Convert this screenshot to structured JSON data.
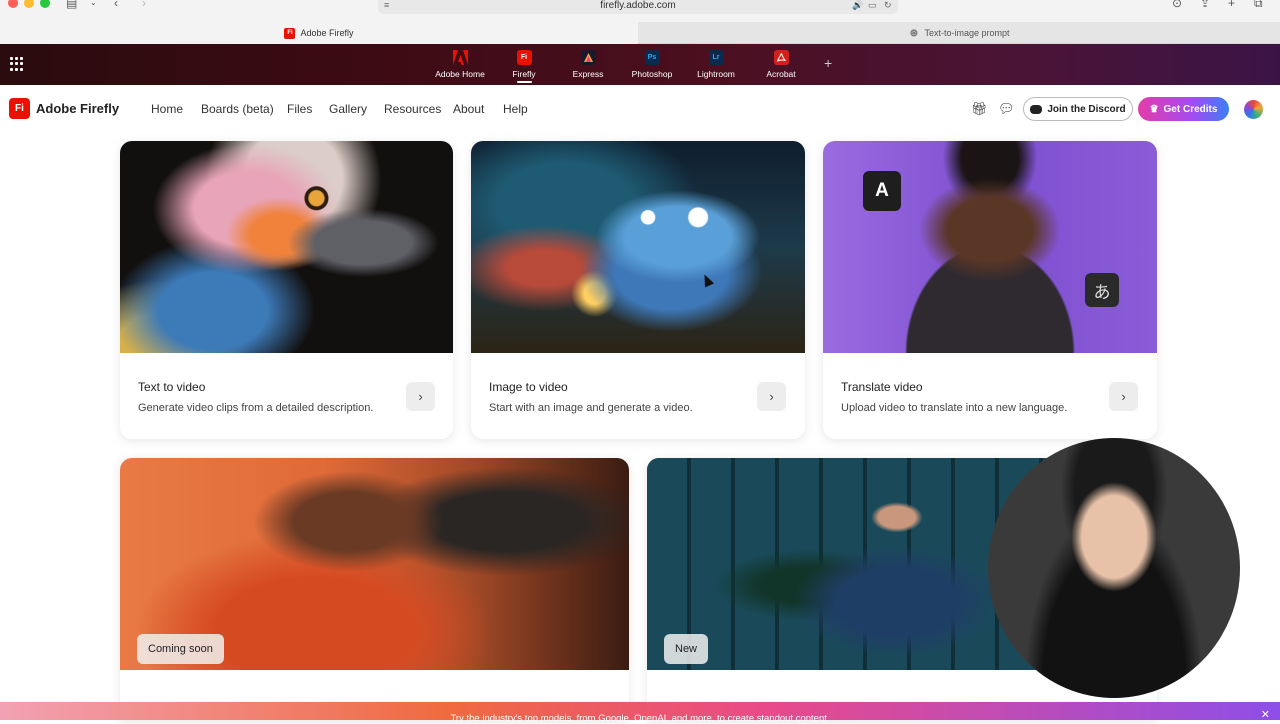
{
  "browser": {
    "url": "firefly.adobe.com",
    "tabs": [
      {
        "label": "Adobe Firefly",
        "active": true
      },
      {
        "label": "Text-to-image prompt",
        "active": false
      }
    ]
  },
  "app_switcher": {
    "apps": [
      {
        "label": "Adobe Home",
        "logo": "adobe",
        "color": "#eb1000"
      },
      {
        "label": "Firefly",
        "logo": "Fi",
        "color": "#eb1000"
      },
      {
        "label": "Express",
        "logo": "A",
        "color": "#1a1a2e"
      },
      {
        "label": "Photoshop",
        "logo": "Ps",
        "color": "#0a2a4e"
      },
      {
        "label": "Lightroom",
        "logo": "Lr",
        "color": "#0a2a4e"
      },
      {
        "label": "Acrobat",
        "logo": "A",
        "color": "#d4201c"
      }
    ],
    "active": "Firefly"
  },
  "header": {
    "logo_text": "Fi",
    "title": "Adobe Firefly",
    "nav": [
      "Home",
      "Boards (beta)",
      "Files",
      "Gallery",
      "Resources",
      "About",
      "Help"
    ],
    "discord_label": "Join the Discord",
    "credits_label": "Get Credits"
  },
  "cards": [
    {
      "title": "Text to video",
      "description": "Generate video clips from a detailed description.",
      "image": "parrot"
    },
    {
      "title": "Image to video",
      "description": "Start with an image and generate a video.",
      "image": "monster"
    },
    {
      "title": "Translate video",
      "description": "Upload video to translate into a new language.",
      "image": "man",
      "overlay_a": "A",
      "overlay_jp": "あ"
    }
  ],
  "lower_cards": [
    {
      "badge": "Coming soon",
      "image": "singer"
    },
    {
      "badge": "New",
      "image": "office"
    }
  ],
  "banner": {
    "text": "Try the industry's top models, from Google, OpenAI, and more, to create standout content."
  },
  "colors": {
    "brand_red": "#eb1000",
    "credits_gradient_start": "#e43caa",
    "credits_gradient_end": "#3b7ff5"
  }
}
